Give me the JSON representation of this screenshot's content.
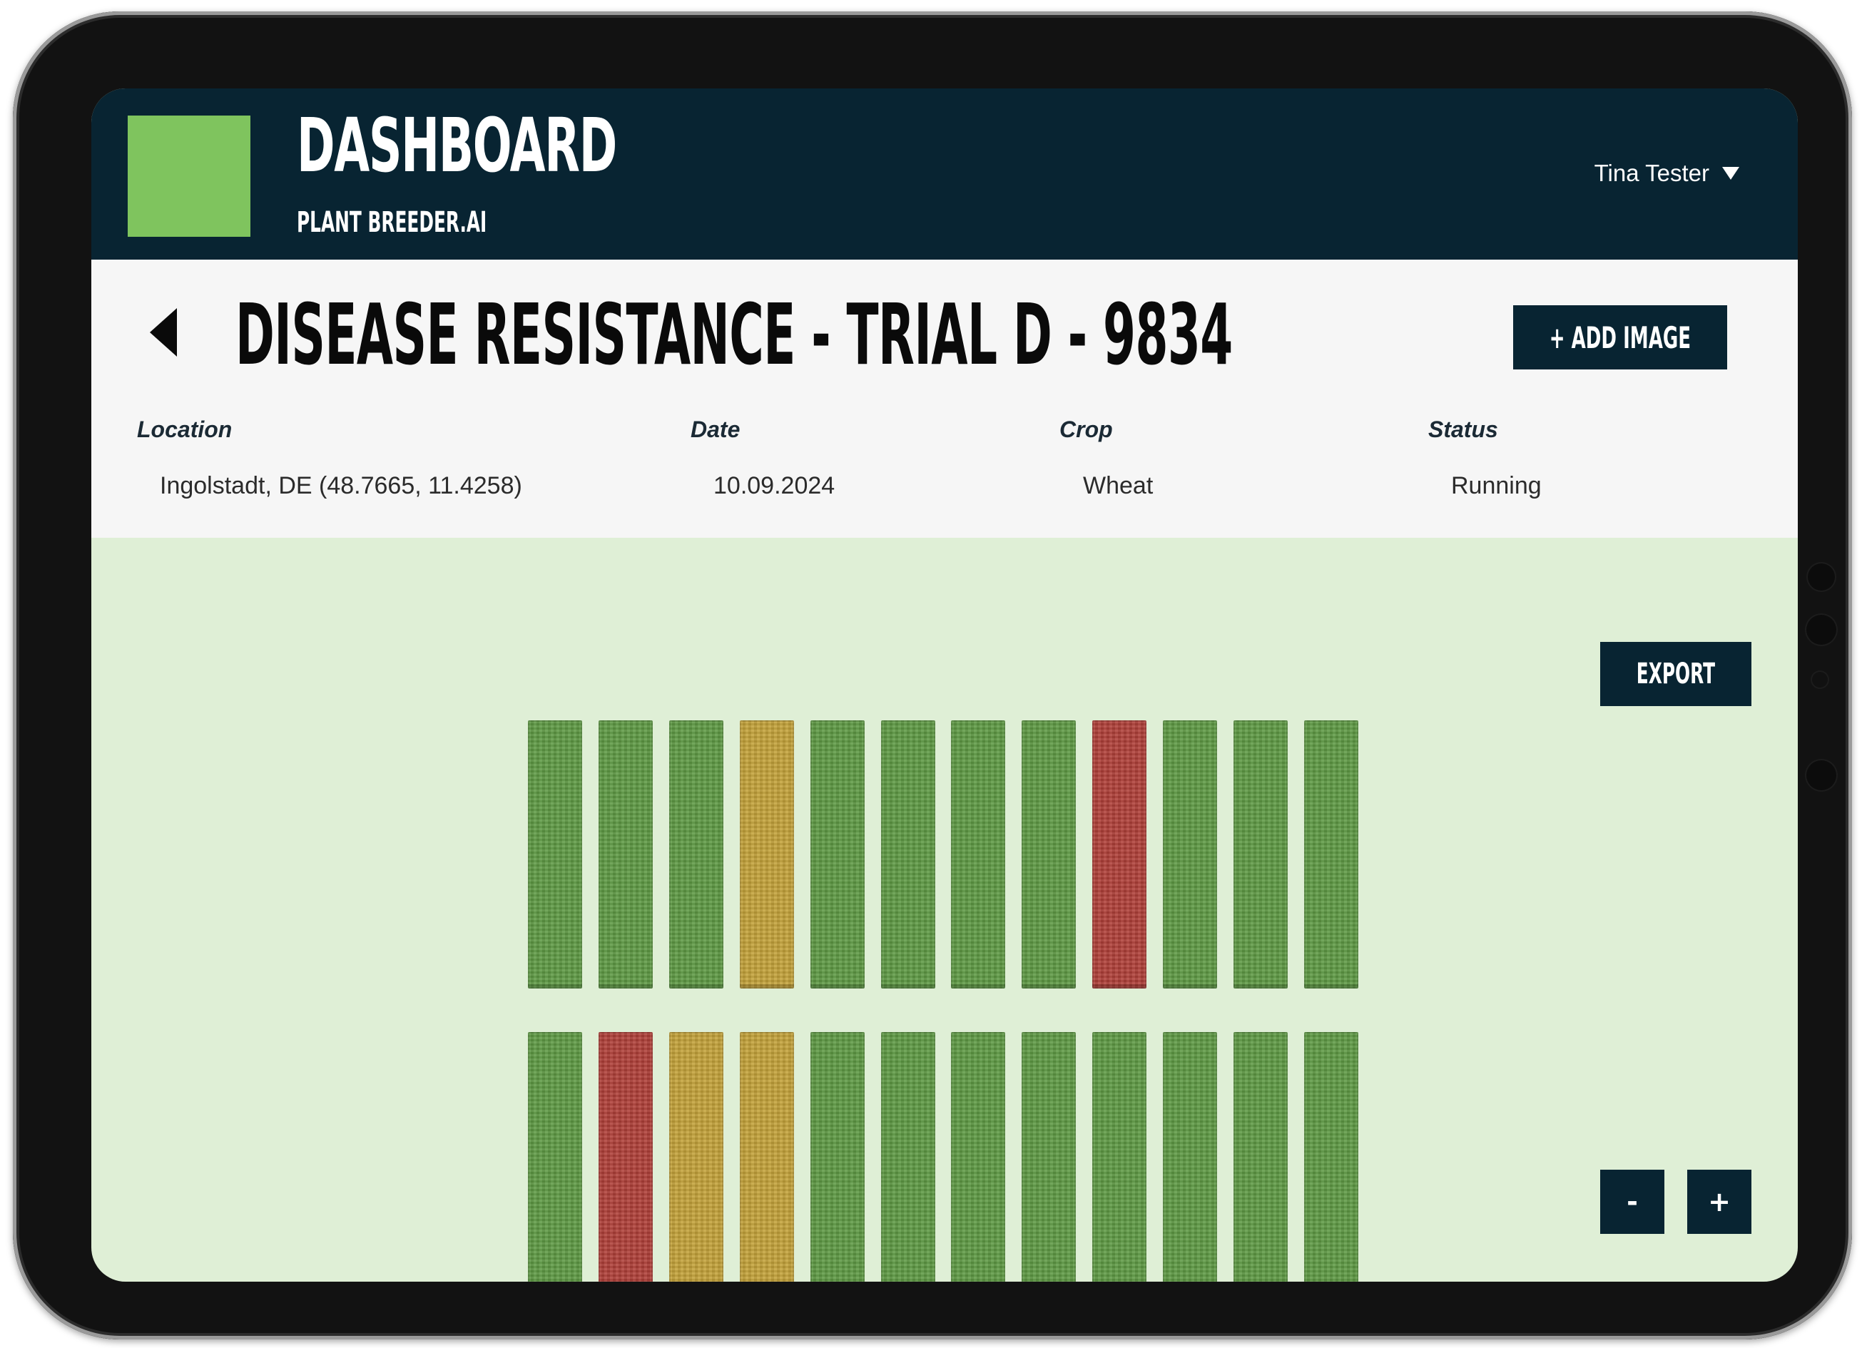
{
  "header": {
    "title": "DASHBOARD",
    "subtitle": "PLANT BREEDER.AI",
    "user_name": "Tina Tester",
    "logo_color": "#7fc45e",
    "bar_color": "#082432"
  },
  "trial": {
    "title": "DISEASE RESISTANCE - TRIAL D - 9834",
    "add_image_label": "+ ADD IMAGE",
    "fields": {
      "location": {
        "label": "Location",
        "value": "Ingolstadt, DE (48.7665, 11.4258)"
      },
      "date": {
        "label": "Date",
        "value": "10.09.2024"
      },
      "crop": {
        "label": "Crop",
        "value": "Wheat"
      },
      "status": {
        "label": "Status",
        "value": "Running"
      }
    }
  },
  "field_map": {
    "export_label": "EXPORT",
    "zoom_out_label": "-",
    "zoom_in_label": "+",
    "status_colors": {
      "healthy": "#5f9a45",
      "moderate": "#c4a33a",
      "infected": "#b04039"
    },
    "rows": [
      [
        "healthy",
        "healthy",
        "healthy",
        "moderate",
        "healthy",
        "healthy",
        "healthy",
        "healthy",
        "infected",
        "healthy",
        "healthy",
        "healthy"
      ],
      [
        "healthy",
        "infected",
        "moderate",
        "moderate",
        "healthy",
        "healthy",
        "healthy",
        "healthy",
        "healthy",
        "healthy",
        "healthy",
        "healthy"
      ]
    ]
  }
}
